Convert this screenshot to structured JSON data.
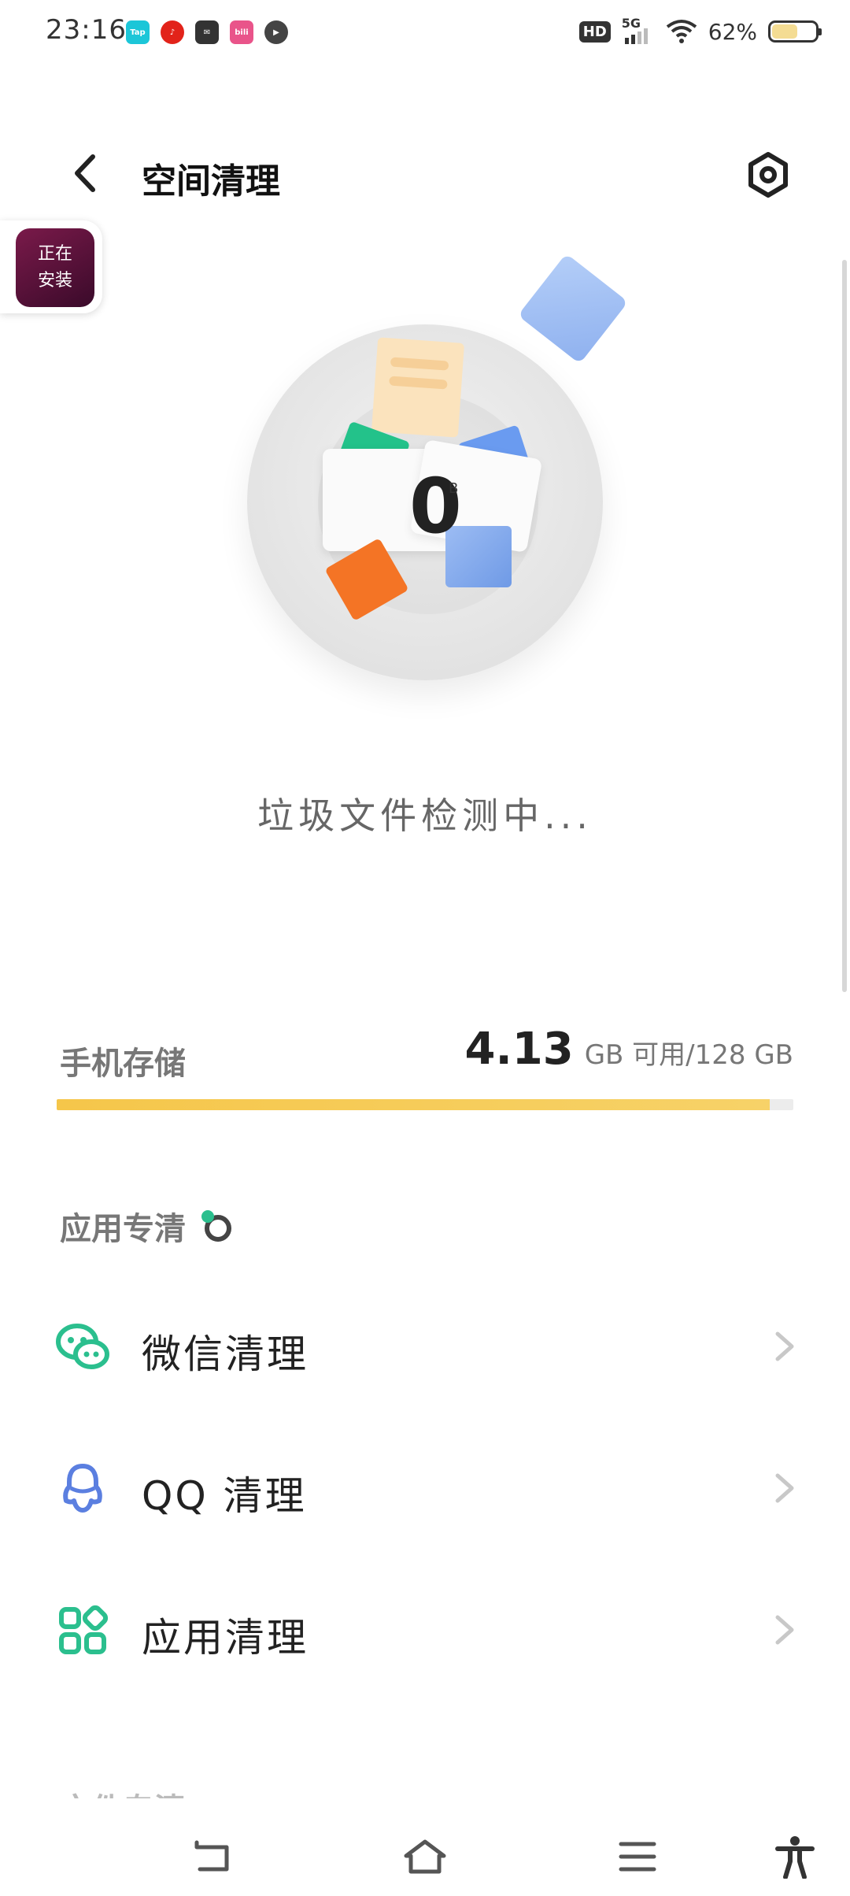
{
  "status_bar": {
    "time": "23:16",
    "notification_icons": [
      "taptap-icon",
      "netease-music-icon",
      "mail-icon",
      "bilibili-icon",
      "video-player-icon"
    ],
    "hd_label": "HD",
    "network_label": "5G",
    "battery_text": "62%",
    "battery_level": 0.62
  },
  "header": {
    "title": "空间清理"
  },
  "installing_badge": {
    "label": "正在\n安装"
  },
  "scan": {
    "amount": "0",
    "unit": "B",
    "status_text": "垃圾文件检测中..."
  },
  "storage": {
    "label": "手机存储",
    "free_value": "4.13",
    "free_unit": "GB 可用/128 GB",
    "used_fraction": 0.968
  },
  "app_cleanup": {
    "section_title": "应用专清",
    "items": [
      {
        "label": "微信清理",
        "icon": "wechat-icon"
      },
      {
        "label": "QQ 清理",
        "icon": "qq-icon"
      },
      {
        "label": "应用清理",
        "icon": "apps-grid-icon"
      }
    ]
  },
  "partial_section_title": "文件专清",
  "colors": {
    "accent_green": "#2bbf8e",
    "qq_blue": "#5b7fe0",
    "storage_yellow": "#f5c64a"
  }
}
